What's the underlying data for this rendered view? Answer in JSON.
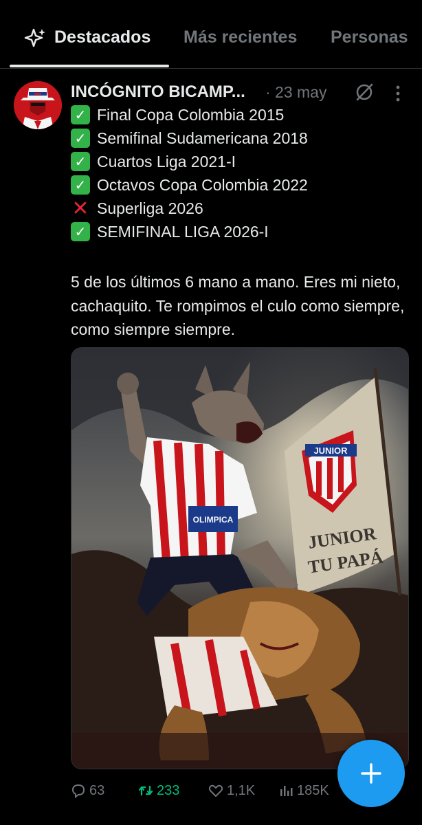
{
  "tabs": [
    {
      "label": "Destacados",
      "active": true
    },
    {
      "label": "Más recientes",
      "active": false
    },
    {
      "label": "Personas",
      "active": false
    }
  ],
  "post": {
    "author_name": "INCÓGNITO BICAMP...",
    "date": "· 23 may",
    "lines": [
      {
        "mark": "check",
        "text": "Final Copa Colombia 2015"
      },
      {
        "mark": "check",
        "text": "Semifinal Sudamericana 2018"
      },
      {
        "mark": "check",
        "text": "Cuartos Liga 2021-I"
      },
      {
        "mark": "check",
        "text": "Octavos Copa Colombia 2022"
      },
      {
        "mark": "cross",
        "text": "Superliga 2026"
      },
      {
        "mark": "check",
        "text": "SEMIFINAL LIGA 2026-I"
      }
    ],
    "paragraph": "5 de los últimos 6 mano a mano. Eres mi nieto, cachaquito. Te rompimos el culo como siempre, como siempre siempre.",
    "image_text": {
      "badge": "JUNIOR",
      "banner_line1": "JUNIOR",
      "banner_line2": "TU PAPÁ",
      "shirt": "OLIMPICA"
    },
    "actions": {
      "replies": "63",
      "reposts": "233",
      "likes": "1,1K",
      "views": "185K"
    }
  },
  "colors": {
    "accent": "#1d9bf0",
    "repost": "#00ba7c",
    "muted": "#71767b",
    "check": "#33b249",
    "cross": "#e3262d"
  },
  "icons": [
    "sparkle-icon",
    "grok-icon",
    "more-icon",
    "reply-icon",
    "repost-icon",
    "like-icon",
    "views-icon",
    "compose-plus-icon"
  ]
}
